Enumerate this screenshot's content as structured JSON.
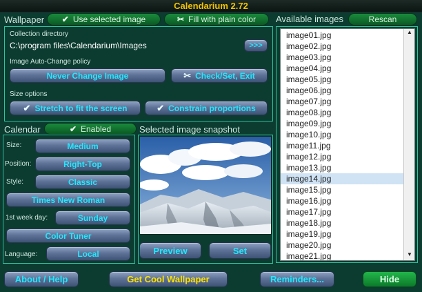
{
  "title": "Calendarium 2.72",
  "wallpaper": {
    "label": "Wallpaper",
    "use_selected_label": "Use selected image",
    "fill_plain_label": "Fill with plain color",
    "collection_dir_label": "Collection directory",
    "collection_dir_value": "C:\\program files\\Calendarium\\Images",
    "browse_label": ">>>",
    "auto_change_label": "Image Auto-Change policy",
    "never_change_label": "Never Change Image",
    "check_set_exit_label": "Check/Set, Exit",
    "size_options_label": "Size options",
    "stretch_label": "Stretch to fit the screen",
    "constrain_label": "Constrain proportions"
  },
  "available": {
    "label": "Available images",
    "rescan_label": "Rescan",
    "items": [
      "image01.jpg",
      "image02.jpg",
      "image03.jpg",
      "image04.jpg",
      "image05.jpg",
      "image06.jpg",
      "image07.jpg",
      "image08.jpg",
      "image09.jpg",
      "image10.jpg",
      "image11.jpg",
      "image12.jpg",
      "image13.jpg",
      "image14.jpg",
      "image15.jpg",
      "image16.jpg",
      "image17.jpg",
      "image18.jpg",
      "image19.jpg",
      "image20.jpg",
      "image21.jpg"
    ],
    "selected": "image14.jpg"
  },
  "calendar": {
    "label": "Calendar",
    "enabled_label": "Enabled",
    "size_label": "Size:",
    "size_value": "Medium",
    "position_label": "Position:",
    "position_value": "Right-Top",
    "style_label": "Style:",
    "style_value": "Classic",
    "font_value": "Times New Roman",
    "week_label": "1st week day:",
    "week_value": "Sunday",
    "color_tuner_label": "Color Tuner",
    "language_label": "Language:",
    "language_value": "Local"
  },
  "snapshot": {
    "label": "Selected image snapshot",
    "preview_label": "Preview",
    "set_label": "Set"
  },
  "footer": {
    "about_label": "About / Help",
    "cool_label": "Get Cool Wallpaper",
    "reminders_label": "Reminders...",
    "hide_label": "Hide"
  },
  "icons": {
    "check": "check-icon",
    "scissors": "scissors-icon"
  },
  "colors": {
    "background": "#0c3c30",
    "panel_border": "#2fc3a0",
    "title": "#f2c200",
    "button_text": "#22e8ff",
    "accent_yellow": "#ffe200",
    "green_button": "#1a8a3c"
  }
}
